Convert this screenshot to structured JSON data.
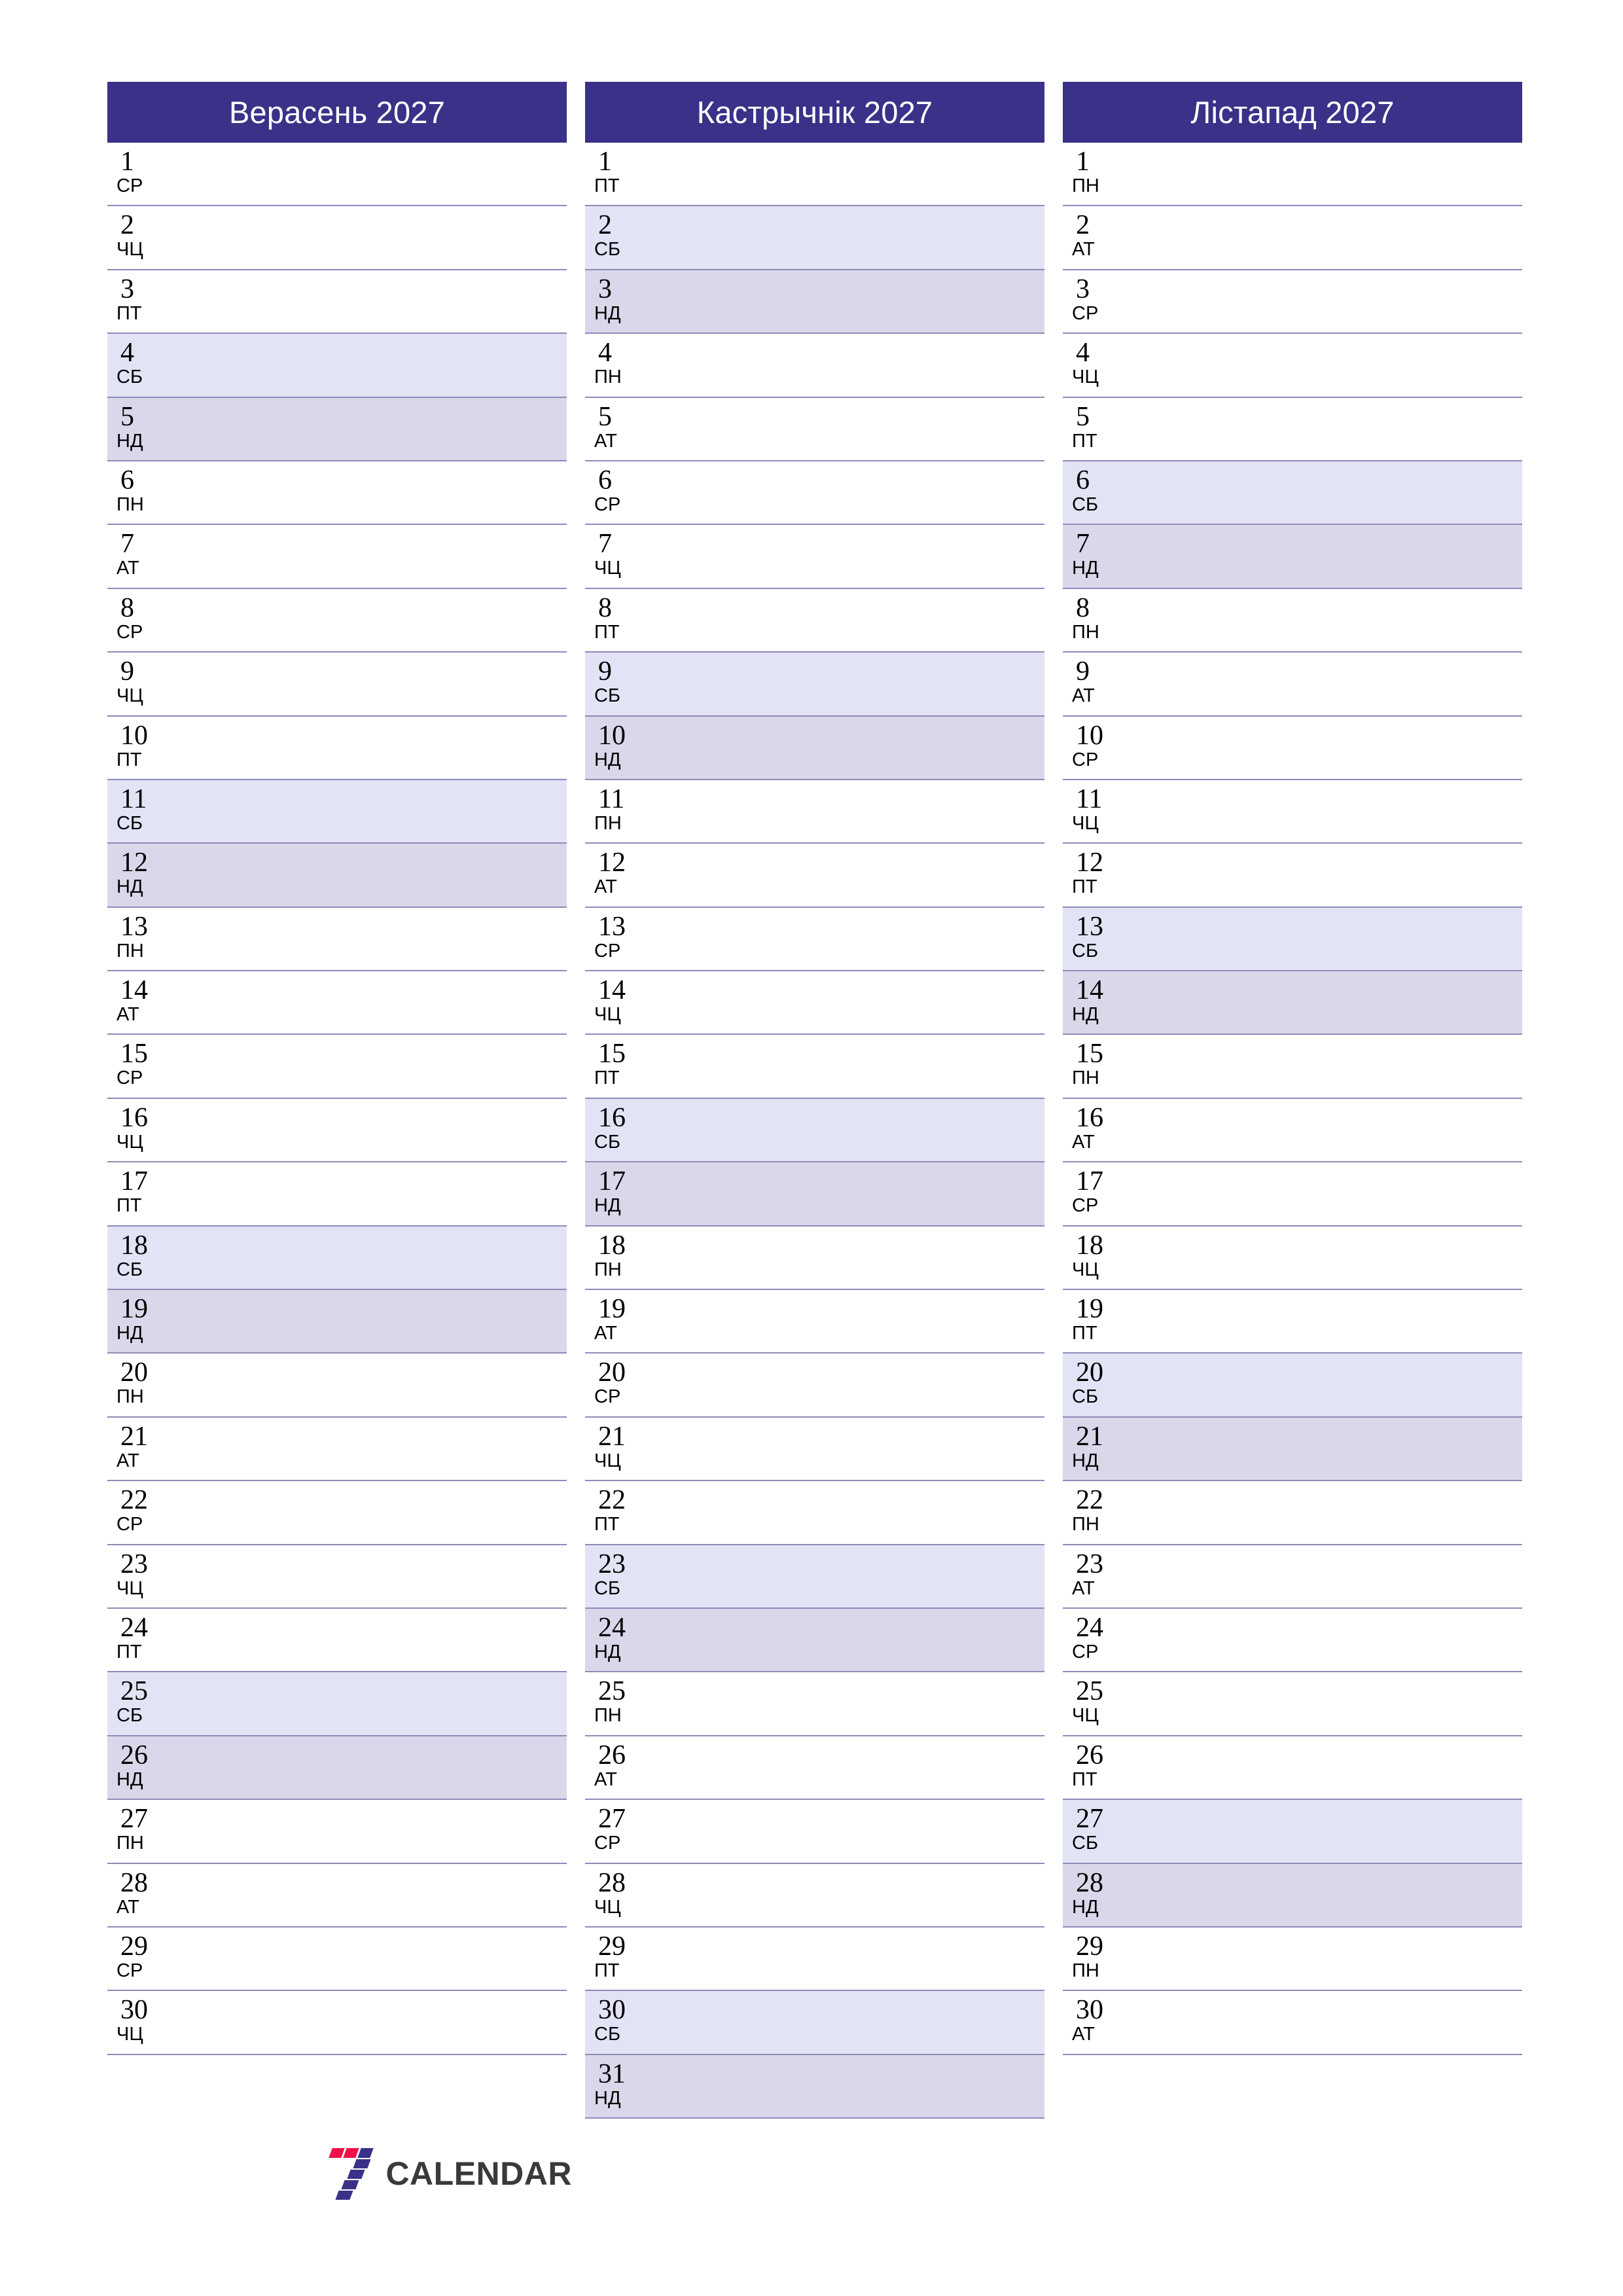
{
  "brand": {
    "logo_icon": "sevencalendar-logo-icon",
    "wordmark": "CALENDAR",
    "mark_colors": {
      "red": "#ef1049",
      "indigo": "#3a3288"
    },
    "text_color": "#3a3a3c"
  },
  "theme": {
    "header_bg": "#3a3288",
    "header_text": "#ffffff",
    "row_border": "#8f8ab9",
    "saturday_bg": "#e3e3f6",
    "sunday_bg": "#dbd7ea",
    "weekday_bg": "#ffffff",
    "text": "#000000"
  },
  "weekday_abbr": {
    "mon": "ПН",
    "tue": "АТ",
    "wed": "СР",
    "thu": "ЧЦ",
    "fri": "ПТ",
    "sat": "СБ",
    "sun": "НД"
  },
  "months": [
    {
      "title": "Верасень 2027",
      "name": "Верасень",
      "year": "2027",
      "days": [
        {
          "n": "1",
          "wd": "СР",
          "type": "weekday"
        },
        {
          "n": "2",
          "wd": "ЧЦ",
          "type": "weekday"
        },
        {
          "n": "3",
          "wd": "ПТ",
          "type": "weekday"
        },
        {
          "n": "4",
          "wd": "СБ",
          "type": "sat"
        },
        {
          "n": "5",
          "wd": "НД",
          "type": "sun"
        },
        {
          "n": "6",
          "wd": "ПН",
          "type": "weekday"
        },
        {
          "n": "7",
          "wd": "АТ",
          "type": "weekday"
        },
        {
          "n": "8",
          "wd": "СР",
          "type": "weekday"
        },
        {
          "n": "9",
          "wd": "ЧЦ",
          "type": "weekday"
        },
        {
          "n": "10",
          "wd": "ПТ",
          "type": "weekday"
        },
        {
          "n": "11",
          "wd": "СБ",
          "type": "sat"
        },
        {
          "n": "12",
          "wd": "НД",
          "type": "sun"
        },
        {
          "n": "13",
          "wd": "ПН",
          "type": "weekday"
        },
        {
          "n": "14",
          "wd": "АТ",
          "type": "weekday"
        },
        {
          "n": "15",
          "wd": "СР",
          "type": "weekday"
        },
        {
          "n": "16",
          "wd": "ЧЦ",
          "type": "weekday"
        },
        {
          "n": "17",
          "wd": "ПТ",
          "type": "weekday"
        },
        {
          "n": "18",
          "wd": "СБ",
          "type": "sat"
        },
        {
          "n": "19",
          "wd": "НД",
          "type": "sun"
        },
        {
          "n": "20",
          "wd": "ПН",
          "type": "weekday"
        },
        {
          "n": "21",
          "wd": "АТ",
          "type": "weekday"
        },
        {
          "n": "22",
          "wd": "СР",
          "type": "weekday"
        },
        {
          "n": "23",
          "wd": "ЧЦ",
          "type": "weekday"
        },
        {
          "n": "24",
          "wd": "ПТ",
          "type": "weekday"
        },
        {
          "n": "25",
          "wd": "СБ",
          "type": "sat"
        },
        {
          "n": "26",
          "wd": "НД",
          "type": "sun"
        },
        {
          "n": "27",
          "wd": "ПН",
          "type": "weekday"
        },
        {
          "n": "28",
          "wd": "АТ",
          "type": "weekday"
        },
        {
          "n": "29",
          "wd": "СР",
          "type": "weekday"
        },
        {
          "n": "30",
          "wd": "ЧЦ",
          "type": "weekday"
        }
      ]
    },
    {
      "title": "Кастрычнік 2027",
      "name": "Кастрычнік",
      "year": "2027",
      "days": [
        {
          "n": "1",
          "wd": "ПТ",
          "type": "weekday"
        },
        {
          "n": "2",
          "wd": "СБ",
          "type": "sat"
        },
        {
          "n": "3",
          "wd": "НД",
          "type": "sun"
        },
        {
          "n": "4",
          "wd": "ПН",
          "type": "weekday"
        },
        {
          "n": "5",
          "wd": "АТ",
          "type": "weekday"
        },
        {
          "n": "6",
          "wd": "СР",
          "type": "weekday"
        },
        {
          "n": "7",
          "wd": "ЧЦ",
          "type": "weekday"
        },
        {
          "n": "8",
          "wd": "ПТ",
          "type": "weekday"
        },
        {
          "n": "9",
          "wd": "СБ",
          "type": "sat"
        },
        {
          "n": "10",
          "wd": "НД",
          "type": "sun"
        },
        {
          "n": "11",
          "wd": "ПН",
          "type": "weekday"
        },
        {
          "n": "12",
          "wd": "АТ",
          "type": "weekday"
        },
        {
          "n": "13",
          "wd": "СР",
          "type": "weekday"
        },
        {
          "n": "14",
          "wd": "ЧЦ",
          "type": "weekday"
        },
        {
          "n": "15",
          "wd": "ПТ",
          "type": "weekday"
        },
        {
          "n": "16",
          "wd": "СБ",
          "type": "sat"
        },
        {
          "n": "17",
          "wd": "НД",
          "type": "sun"
        },
        {
          "n": "18",
          "wd": "ПН",
          "type": "weekday"
        },
        {
          "n": "19",
          "wd": "АТ",
          "type": "weekday"
        },
        {
          "n": "20",
          "wd": "СР",
          "type": "weekday"
        },
        {
          "n": "21",
          "wd": "ЧЦ",
          "type": "weekday"
        },
        {
          "n": "22",
          "wd": "ПТ",
          "type": "weekday"
        },
        {
          "n": "23",
          "wd": "СБ",
          "type": "sat"
        },
        {
          "n": "24",
          "wd": "НД",
          "type": "sun"
        },
        {
          "n": "25",
          "wd": "ПН",
          "type": "weekday"
        },
        {
          "n": "26",
          "wd": "АТ",
          "type": "weekday"
        },
        {
          "n": "27",
          "wd": "СР",
          "type": "weekday"
        },
        {
          "n": "28",
          "wd": "ЧЦ",
          "type": "weekday"
        },
        {
          "n": "29",
          "wd": "ПТ",
          "type": "weekday"
        },
        {
          "n": "30",
          "wd": "СБ",
          "type": "sat"
        },
        {
          "n": "31",
          "wd": "НД",
          "type": "sun"
        }
      ]
    },
    {
      "title": "Лістапад 2027",
      "name": "Лістапад",
      "year": "2027",
      "days": [
        {
          "n": "1",
          "wd": "ПН",
          "type": "weekday"
        },
        {
          "n": "2",
          "wd": "АТ",
          "type": "weekday"
        },
        {
          "n": "3",
          "wd": "СР",
          "type": "weekday"
        },
        {
          "n": "4",
          "wd": "ЧЦ",
          "type": "weekday"
        },
        {
          "n": "5",
          "wd": "ПТ",
          "type": "weekday"
        },
        {
          "n": "6",
          "wd": "СБ",
          "type": "sat"
        },
        {
          "n": "7",
          "wd": "НД",
          "type": "sun"
        },
        {
          "n": "8",
          "wd": "ПН",
          "type": "weekday"
        },
        {
          "n": "9",
          "wd": "АТ",
          "type": "weekday"
        },
        {
          "n": "10",
          "wd": "СР",
          "type": "weekday"
        },
        {
          "n": "11",
          "wd": "ЧЦ",
          "type": "weekday"
        },
        {
          "n": "12",
          "wd": "ПТ",
          "type": "weekday"
        },
        {
          "n": "13",
          "wd": "СБ",
          "type": "sat"
        },
        {
          "n": "14",
          "wd": "НД",
          "type": "sun"
        },
        {
          "n": "15",
          "wd": "ПН",
          "type": "weekday"
        },
        {
          "n": "16",
          "wd": "АТ",
          "type": "weekday"
        },
        {
          "n": "17",
          "wd": "СР",
          "type": "weekday"
        },
        {
          "n": "18",
          "wd": "ЧЦ",
          "type": "weekday"
        },
        {
          "n": "19",
          "wd": "ПТ",
          "type": "weekday"
        },
        {
          "n": "20",
          "wd": "СБ",
          "type": "sat"
        },
        {
          "n": "21",
          "wd": "НД",
          "type": "sun"
        },
        {
          "n": "22",
          "wd": "ПН",
          "type": "weekday"
        },
        {
          "n": "23",
          "wd": "АТ",
          "type": "weekday"
        },
        {
          "n": "24",
          "wd": "СР",
          "type": "weekday"
        },
        {
          "n": "25",
          "wd": "ЧЦ",
          "type": "weekday"
        },
        {
          "n": "26",
          "wd": "ПТ",
          "type": "weekday"
        },
        {
          "n": "27",
          "wd": "СБ",
          "type": "sat"
        },
        {
          "n": "28",
          "wd": "НД",
          "type": "sun"
        },
        {
          "n": "29",
          "wd": "ПН",
          "type": "weekday"
        },
        {
          "n": "30",
          "wd": "АТ",
          "type": "weekday"
        }
      ]
    }
  ]
}
